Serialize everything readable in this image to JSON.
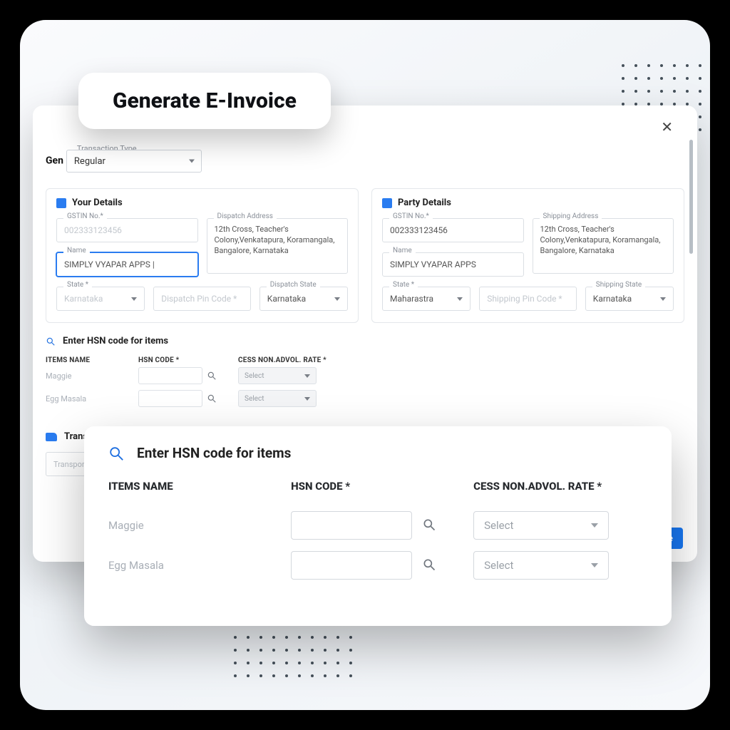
{
  "title_chip": "Generate E-Invoice",
  "panel_title": "Gen",
  "transaction_type": {
    "label": "Transaction Type",
    "value": "Regular"
  },
  "your_details": {
    "heading": "Your Details",
    "gstin": {
      "label": "GSTIN No.*",
      "value": "002333123456"
    },
    "name": {
      "label": "Name",
      "value": "SIMPLY VYAPAR APPS |"
    },
    "state": {
      "label": "State *",
      "value": "Karnataka"
    },
    "dispatch_address": {
      "label": "Dispatch Address",
      "value": "12th Cross, Teacher's Colony,Venkatapura, Koramangala, Bangalore, Karnataka"
    },
    "dispatch_pin": {
      "label": "Dispatch Pin Code *"
    },
    "dispatch_state": {
      "label": "Dispatch State",
      "value": "Karnataka"
    }
  },
  "party_details": {
    "heading": "Party Details",
    "gstin": {
      "label": "GSTIN No.*",
      "value": "002333123456"
    },
    "name": {
      "label": "Name",
      "value": "SIMPLY VYAPAR APPS"
    },
    "state": {
      "label": "State *",
      "value": "Maharastra"
    },
    "shipping_address": {
      "label": "Shipping Address",
      "value": "12th Cross, Teacher's Colony,Venkatapura, Koramangala, Bangalore, Karnataka"
    },
    "shipping_pin": {
      "label": "Shipping Pin Code *"
    },
    "shipping_state": {
      "label": "Shipping State",
      "value": "Karnataka"
    }
  },
  "hsn": {
    "heading": "Enter HSN code for items",
    "cols": {
      "name": "ITEMS NAME",
      "code": "HSN CODE *",
      "cess": "CESS NON.ADVOL. RATE *"
    },
    "rows": [
      {
        "name": "Maggie",
        "cess": "Select"
      },
      {
        "name": "Egg Masala",
        "cess": "Select"
      }
    ]
  },
  "transport": {
    "heading": "Transpo",
    "placeholder": "Transporter"
  },
  "generate_btn": "te",
  "zoom": {
    "heading": "Enter HSN code for items",
    "cols": {
      "name": "ITEMS NAME",
      "code": "HSN CODE *",
      "cess": "CESS NON.ADVOL. RATE *"
    },
    "rows": [
      {
        "name": "Maggie",
        "cess": "Select"
      },
      {
        "name": "Egg Masala",
        "cess": "Select"
      }
    ]
  }
}
